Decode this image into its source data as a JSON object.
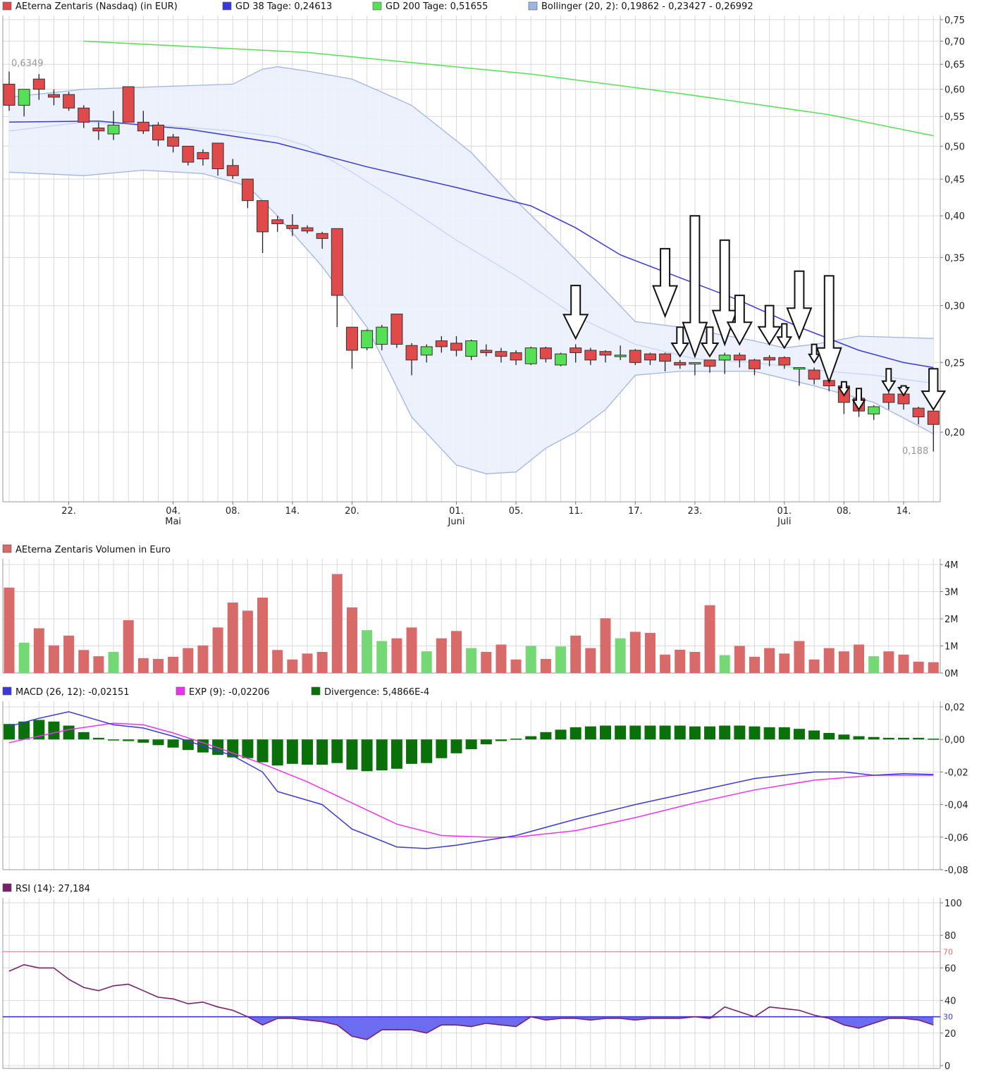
{
  "colors": {
    "up": "#55e055",
    "down": "#e04a4a",
    "gd38": "#3a3ad8",
    "gd200": "#55e055",
    "bollinger": "#9fb4e6",
    "bollinger_fill": "#eaf0fc",
    "macd": "#3a3ad8",
    "exp": "#ee33ee",
    "divergence": "#0a700a",
    "rsi": "#7a1f6e",
    "rsi_fill": "#6c6cf0",
    "rsi_line70": "#e07070",
    "rsi_line30": "#3a3ad8",
    "vol_up": "#74d874",
    "vol_down": "#d86a6a",
    "grid": "#d9d9d9"
  },
  "legend": {
    "price": "AEterna Zentaris (Nasdaq) (in EUR)",
    "gd38": "GD 38 Tage: 0,24613",
    "gd200": "GD 200 Tage: 0,51655",
    "bollinger": "Bollinger (20, 2): 0,19862 - 0,23427 - 0,26992",
    "volume": "AEterna Zentaris Volumen in Euro",
    "macd": "MACD (26, 12): -0,02151",
    "exp": "EXP (9): -0,02206",
    "divergence": "Divergence: 5,4866E-4",
    "rsi": "RSI (14): 27,184"
  },
  "annotations": {
    "high": "0,6349",
    "low": "0,188"
  },
  "chart_data": [
    {
      "type": "candlestick",
      "axis": "y",
      "yscale": "log",
      "ylim": [
        0.16,
        0.76
      ],
      "yticks": [
        0.2,
        0.25,
        0.3,
        0.35,
        0.4,
        0.45,
        0.5,
        0.55,
        0.6,
        0.65,
        0.7,
        0.75
      ],
      "ytick_labels": [
        "0,20",
        "0,25",
        "0,30",
        "0,35",
        "0,40",
        "0,45",
        "0,50",
        "0,55",
        "0,60",
        "0,65",
        "0,70",
        "0,75"
      ],
      "xtick_labels": [
        {
          "i": 4,
          "label": "22.",
          "sub": ""
        },
        {
          "i": 11,
          "label": "04.",
          "sub": "Mai"
        },
        {
          "i": 15,
          "label": "08.",
          "sub": ""
        },
        {
          "i": 19,
          "label": "14.",
          "sub": ""
        },
        {
          "i": 23,
          "label": "20.",
          "sub": ""
        },
        {
          "i": 30,
          "label": "01.",
          "sub": "Juni"
        },
        {
          "i": 34,
          "label": "05.",
          "sub": ""
        },
        {
          "i": 38,
          "label": "11.",
          "sub": ""
        },
        {
          "i": 42,
          "label": "17.",
          "sub": ""
        },
        {
          "i": 46,
          "label": "23.",
          "sub": ""
        },
        {
          "i": 52,
          "label": "01.",
          "sub": "Juli"
        },
        {
          "i": 56,
          "label": "08.",
          "sub": ""
        },
        {
          "i": 60,
          "label": "14.",
          "sub": ""
        }
      ],
      "candles": [
        [
          0.61,
          0.57,
          0.635,
          0.56
        ],
        [
          0.57,
          0.6,
          0.6,
          0.55
        ],
        [
          0.62,
          0.6,
          0.63,
          0.58
        ],
        [
          0.59,
          0.585,
          0.6,
          0.57
        ],
        [
          0.59,
          0.565,
          0.595,
          0.56
        ],
        [
          0.565,
          0.54,
          0.57,
          0.53
        ],
        [
          0.53,
          0.525,
          0.54,
          0.51
        ],
        [
          0.52,
          0.535,
          0.56,
          0.51
        ],
        [
          0.605,
          0.54,
          0.605,
          0.54
        ],
        [
          0.54,
          0.525,
          0.56,
          0.52
        ],
        [
          0.535,
          0.51,
          0.54,
          0.5
        ],
        [
          0.515,
          0.5,
          0.52,
          0.49
        ],
        [
          0.5,
          0.475,
          0.5,
          0.47
        ],
        [
          0.49,
          0.48,
          0.495,
          0.47
        ],
        [
          0.505,
          0.465,
          0.505,
          0.455
        ],
        [
          0.47,
          0.455,
          0.48,
          0.45
        ],
        [
          0.45,
          0.42,
          0.45,
          0.41
        ],
        [
          0.42,
          0.38,
          0.42,
          0.355
        ],
        [
          0.395,
          0.39,
          0.4,
          0.38
        ],
        [
          0.388,
          0.384,
          0.402,
          0.375
        ],
        [
          0.385,
          0.381,
          0.388,
          0.378
        ],
        [
          0.378,
          0.372,
          0.38,
          0.36
        ],
        [
          0.384,
          0.31,
          0.384,
          0.28
        ],
        [
          0.28,
          0.26,
          0.28,
          0.245
        ],
        [
          0.262,
          0.277,
          0.278,
          0.26
        ],
        [
          0.265,
          0.28,
          0.282,
          0.26
        ],
        [
          0.292,
          0.265,
          0.292,
          0.262
        ],
        [
          0.264,
          0.252,
          0.266,
          0.24
        ],
        [
          0.256,
          0.263,
          0.265,
          0.25
        ],
        [
          0.268,
          0.263,
          0.272,
          0.258
        ],
        [
          0.266,
          0.26,
          0.272,
          0.255
        ],
        [
          0.255,
          0.268,
          0.269,
          0.252
        ],
        [
          0.26,
          0.258,
          0.265,
          0.255
        ],
        [
          0.259,
          0.255,
          0.262,
          0.25
        ],
        [
          0.258,
          0.252,
          0.26,
          0.248
        ],
        [
          0.249,
          0.262,
          0.263,
          0.248
        ],
        [
          0.262,
          0.253,
          0.263,
          0.25
        ],
        [
          0.248,
          0.257,
          0.258,
          0.247
        ],
        [
          0.262,
          0.258,
          0.265,
          0.25
        ],
        [
          0.26,
          0.252,
          0.262,
          0.248
        ],
        [
          0.259,
          0.256,
          0.26,
          0.25
        ],
        [
          0.255,
          0.256,
          0.264,
          0.252
        ],
        [
          0.26,
          0.25,
          0.261,
          0.248
        ],
        [
          0.257,
          0.252,
          0.258,
          0.248
        ],
        [
          0.257,
          0.251,
          0.258,
          0.243
        ],
        [
          0.25,
          0.248,
          0.252,
          0.245
        ],
        [
          0.25,
          0.25,
          0.25,
          0.24
        ],
        [
          0.252,
          0.247,
          0.252,
          0.242
        ],
        [
          0.252,
          0.256,
          0.258,
          0.241
        ],
        [
          0.256,
          0.252,
          0.258,
          0.246
        ],
        [
          0.252,
          0.245,
          0.253,
          0.24
        ],
        [
          0.254,
          0.252,
          0.256,
          0.247
        ],
        [
          0.254,
          0.248,
          0.255,
          0.245
        ],
        [
          0.246,
          0.246,
          0.246,
          0.232
        ],
        [
          0.244,
          0.237,
          0.246,
          0.233
        ],
        [
          0.236,
          0.232,
          0.239,
          0.228
        ],
        [
          0.232,
          0.22,
          0.232,
          0.212
        ],
        [
          0.223,
          0.214,
          0.223,
          0.21
        ],
        [
          0.212,
          0.217,
          0.218,
          0.208
        ],
        [
          0.226,
          0.22,
          0.23,
          0.215
        ],
        [
          0.226,
          0.219,
          0.227,
          0.215
        ],
        [
          0.216,
          0.21,
          0.217,
          0.205
        ],
        [
          0.214,
          0.205,
          0.214,
          0.188
        ]
      ],
      "gd38": [
        [
          0,
          0.54
        ],
        [
          6,
          0.542
        ],
        [
          12,
          0.528
        ],
        [
          18,
          0.505
        ],
        [
          24,
          0.468
        ],
        [
          30,
          0.438
        ],
        [
          35,
          0.413
        ],
        [
          38,
          0.385
        ],
        [
          41,
          0.353
        ],
        [
          45,
          0.328
        ],
        [
          49,
          0.305
        ],
        [
          53,
          0.28
        ],
        [
          57,
          0.26
        ],
        [
          60,
          0.25
        ],
        [
          62,
          0.246
        ]
      ],
      "gd200": [
        [
          5,
          0.7
        ],
        [
          20,
          0.675
        ],
        [
          35,
          0.63
        ],
        [
          45,
          0.592
        ],
        [
          55,
          0.553
        ],
        [
          62,
          0.517
        ]
      ],
      "bollinger_upper": [
        [
          0,
          0.585
        ],
        [
          5,
          0.6
        ],
        [
          10,
          0.605
        ],
        [
          15,
          0.61
        ],
        [
          17,
          0.64
        ],
        [
          18,
          0.645
        ],
        [
          20,
          0.636
        ],
        [
          23,
          0.62
        ],
        [
          27,
          0.57
        ],
        [
          31,
          0.49
        ],
        [
          34,
          0.42
        ],
        [
          37,
          0.365
        ],
        [
          40,
          0.315
        ],
        [
          42,
          0.285
        ],
        [
          45,
          0.28
        ],
        [
          50,
          0.268
        ],
        [
          52,
          0.262
        ],
        [
          54,
          0.265
        ],
        [
          57,
          0.272
        ],
        [
          62,
          0.27
        ]
      ],
      "bollinger_middle": [
        [
          0,
          0.525
        ],
        [
          5,
          0.54
        ],
        [
          10,
          0.535
        ],
        [
          15,
          0.525
        ],
        [
          18,
          0.515
        ],
        [
          20,
          0.5
        ],
        [
          23,
          0.46
        ],
        [
          26,
          0.42
        ],
        [
          30,
          0.37
        ],
        [
          34,
          0.33
        ],
        [
          38,
          0.29
        ],
        [
          42,
          0.265
        ],
        [
          46,
          0.253
        ],
        [
          50,
          0.25
        ],
        [
          54,
          0.244
        ],
        [
          58,
          0.24
        ],
        [
          62,
          0.234
        ]
      ],
      "bollinger_lower": [
        [
          0,
          0.46
        ],
        [
          5,
          0.455
        ],
        [
          9,
          0.463
        ],
        [
          13,
          0.458
        ],
        [
          16,
          0.44
        ],
        [
          18,
          0.4
        ],
        [
          21,
          0.34
        ],
        [
          24,
          0.28
        ],
        [
          27,
          0.21
        ],
        [
          30,
          0.18
        ],
        [
          32,
          0.175
        ],
        [
          34,
          0.176
        ],
        [
          36,
          0.19
        ],
        [
          38,
          0.2
        ],
        [
          40,
          0.215
        ],
        [
          42,
          0.24
        ],
        [
          45,
          0.243
        ],
        [
          50,
          0.243
        ],
        [
          54,
          0.232
        ],
        [
          58,
          0.22
        ],
        [
          62,
          0.199
        ]
      ],
      "arrows": [
        [
          38,
          0.27,
          0.32
        ],
        [
          44,
          0.29,
          0.36
        ],
        [
          45,
          0.255,
          0.28
        ],
        [
          46,
          0.255,
          0.4
        ],
        [
          47,
          0.255,
          0.28
        ],
        [
          48,
          0.265,
          0.37
        ],
        [
          49,
          0.265,
          0.31
        ],
        [
          51,
          0.265,
          0.3
        ],
        [
          52,
          0.262,
          0.283
        ],
        [
          53,
          0.27,
          0.335
        ],
        [
          54,
          0.25,
          0.265
        ],
        [
          55,
          0.235,
          0.33
        ],
        [
          56,
          0.225,
          0.235
        ],
        [
          57,
          0.215,
          0.23
        ],
        [
          59,
          0.228,
          0.245
        ],
        [
          60,
          0.225,
          0.232
        ],
        [
          62,
          0.215,
          0.245
        ]
      ]
    },
    {
      "type": "bar",
      "axis": "volume",
      "ylim": [
        0,
        4
      ],
      "yticks": [
        0,
        1,
        2,
        3,
        4
      ],
      "ytick_labels": [
        "0M",
        "1M",
        "2M",
        "3M",
        "4M"
      ],
      "values": [
        3.15,
        1.12,
        1.65,
        1.02,
        1.38,
        0.85,
        0.62,
        0.78,
        1.95,
        0.55,
        0.52,
        0.6,
        0.92,
        1.02,
        1.68,
        2.6,
        2.3,
        2.78,
        0.85,
        0.5,
        0.72,
        0.78,
        3.65,
        2.42,
        1.58,
        1.18,
        1.28,
        1.68,
        0.8,
        1.28,
        1.55,
        0.92,
        0.78,
        1.05,
        0.5,
        1.0,
        0.52,
        0.98,
        1.38,
        0.92,
        2.02,
        1.28,
        1.52,
        1.48,
        0.68,
        0.86,
        0.78,
        2.5,
        0.66,
        1.0,
        0.6,
        0.92,
        0.72,
        1.18,
        0.5,
        0.92,
        0.8,
        1.05,
        0.62,
        0.8,
        0.68,
        0.42,
        0.4
      ]
    },
    {
      "type": "bar_line",
      "axis": "macd",
      "ylim": [
        -0.08,
        0.02
      ],
      "yticks": [
        -0.08,
        -0.06,
        -0.04,
        -0.02,
        0,
        0.02
      ],
      "ytick_labels": [
        "-0,08",
        "-0,06",
        "-0,04",
        "-0,02",
        "0,00",
        "0,02"
      ],
      "divergence": [
        0.0095,
        0.011,
        0.012,
        0.011,
        0.0085,
        0.0045,
        0.001,
        0,
        -0.001,
        -0.002,
        -0.0035,
        -0.005,
        -0.0065,
        -0.008,
        -0.0095,
        -0.011,
        -0.0115,
        -0.014,
        -0.016,
        -0.015,
        -0.0155,
        -0.0155,
        -0.0145,
        -0.0185,
        -0.0195,
        -0.019,
        -0.018,
        -0.015,
        -0.0145,
        -0.0115,
        -0.0085,
        -0.006,
        -0.003,
        -0.001,
        0.0005,
        0.002,
        0.0045,
        0.006,
        0.0075,
        0.008,
        0.0085,
        0.0085,
        0.0085,
        0.0085,
        0.0085,
        0.0085,
        0.008,
        0.008,
        0.0085,
        0.0085,
        0.008,
        0.0075,
        0.0075,
        0.0065,
        0.0055,
        0.004,
        0.003,
        0.002,
        0.0015,
        0.001,
        0.001,
        0.001,
        0.0005
      ],
      "macd": [
        [
          0,
          0.008
        ],
        [
          2,
          0.013
        ],
        [
          4,
          0.017
        ],
        [
          7,
          0.009
        ],
        [
          9,
          0.007
        ],
        [
          11,
          0.002
        ],
        [
          13,
          -0.004
        ],
        [
          15,
          -0.01
        ],
        [
          17,
          -0.02
        ],
        [
          18,
          -0.032
        ],
        [
          21,
          -0.04
        ],
        [
          23,
          -0.055
        ],
        [
          26,
          -0.066
        ],
        [
          28,
          -0.067
        ],
        [
          30,
          -0.065
        ],
        [
          34,
          -0.059
        ],
        [
          38,
          -0.049
        ],
        [
          42,
          -0.04
        ],
        [
          46,
          -0.032
        ],
        [
          50,
          -0.024
        ],
        [
          54,
          -0.02
        ],
        [
          56,
          -0.02
        ],
        [
          58,
          -0.022
        ],
        [
          60,
          -0.021
        ],
        [
          62,
          -0.0215
        ]
      ],
      "exp": [
        [
          0,
          -0.002
        ],
        [
          4,
          0.006
        ],
        [
          7,
          0.01
        ],
        [
          9,
          0.009
        ],
        [
          11,
          0.004
        ],
        [
          14,
          -0.005
        ],
        [
          17,
          -0.015
        ],
        [
          20,
          -0.026
        ],
        [
          23,
          -0.039
        ],
        [
          26,
          -0.052
        ],
        [
          29,
          -0.059
        ],
        [
          32,
          -0.06
        ],
        [
          34,
          -0.06
        ],
        [
          38,
          -0.056
        ],
        [
          42,
          -0.048
        ],
        [
          46,
          -0.039
        ],
        [
          50,
          -0.031
        ],
        [
          54,
          -0.025
        ],
        [
          58,
          -0.022
        ],
        [
          62,
          -0.022
        ]
      ]
    },
    {
      "type": "line",
      "axis": "rsi",
      "ylim": [
        0,
        100
      ],
      "yticks": [
        0,
        20,
        40,
        60,
        80,
        100
      ],
      "ytick_labels": [
        "0",
        "20",
        "40",
        "60",
        "80",
        "100"
      ],
      "levels": [
        {
          "value": 70,
          "label": "70"
        },
        {
          "value": 30,
          "label": "30"
        }
      ],
      "values": [
        58,
        62,
        60,
        60,
        53,
        48,
        46,
        49,
        50,
        46,
        42,
        41,
        38,
        39,
        36,
        34,
        30,
        25,
        29,
        29,
        28,
        27,
        25,
        18,
        16,
        22,
        22,
        22,
        20,
        25,
        25,
        24,
        26,
        25,
        24,
        30,
        28,
        29,
        29,
        28,
        29,
        29,
        28,
        29,
        29,
        29,
        30,
        29,
        36,
        33,
        30,
        36,
        35,
        34,
        31,
        29,
        25,
        23,
        26,
        29,
        29,
        28,
        25
      ]
    }
  ]
}
